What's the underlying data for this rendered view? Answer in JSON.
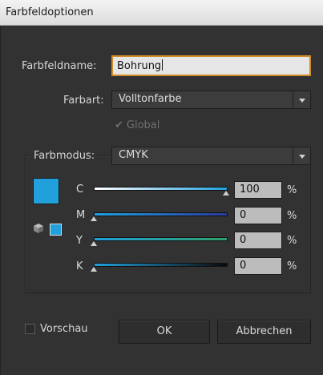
{
  "window": {
    "title": "Farbfeldoptionen"
  },
  "fields": {
    "name_label": "Farbfeldname:",
    "name_value": "Bohrung",
    "type_label": "Farbart:",
    "type_value": "Volltonfarbe",
    "global_label": "Global",
    "global_checked": true,
    "global_disabled": true,
    "mode_label": "Farbmodus:",
    "mode_value": "CMYK"
  },
  "channels": [
    {
      "label": "C",
      "value": "100",
      "unit": "%",
      "level": 1.0,
      "gradient": [
        "#ffffff",
        "#22a0dc"
      ]
    },
    {
      "label": "M",
      "value": "0",
      "unit": "%",
      "level": 0.0,
      "gradient": [
        "#22a0dc",
        "#2a3a9a"
      ]
    },
    {
      "label": "Y",
      "value": "0",
      "unit": "%",
      "level": 0.0,
      "gradient": [
        "#22a0dc",
        "#2fa06a"
      ]
    },
    {
      "label": "K",
      "value": "0",
      "unit": "%",
      "level": 0.0,
      "gradient": [
        "#22a0dc",
        "#0a0a0a"
      ]
    }
  ],
  "swatch_color": "#22a0dc",
  "icons": {
    "gamut": "cube-icon"
  },
  "footer": {
    "preview_label": "Vorschau",
    "preview_checked": false,
    "ok_label": "OK",
    "cancel_label": "Abbrechen"
  }
}
